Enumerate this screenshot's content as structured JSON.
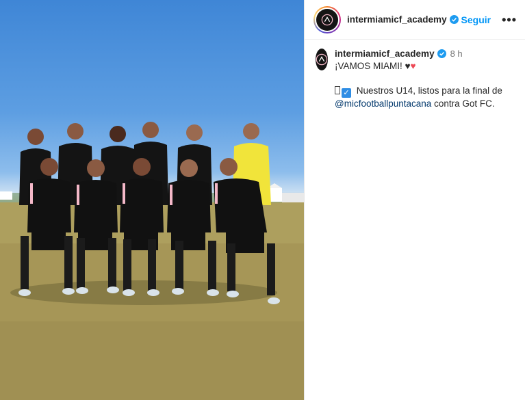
{
  "post": {
    "username": "intermiamicf_academy",
    "follow_label": "Seguir",
    "more_label": "•••",
    "time": "8 h",
    "caption": {
      "line1": "¡VAMOS MIAMI!",
      "line2_prefix": "Nuestros U14, listos para la final de",
      "mention": "@micfootballpuntacana",
      "line2_suffix": "contra Got FC."
    }
  },
  "photo": {
    "subject": "team-photo",
    "kit_color": "#111111",
    "accent_color": "#f4b8c8",
    "keeper_color": "#f1e43a"
  },
  "colors": {
    "link_blue": "#0095f6",
    "mention_blue": "#00376b",
    "verified_blue": "#1d9bf0"
  }
}
